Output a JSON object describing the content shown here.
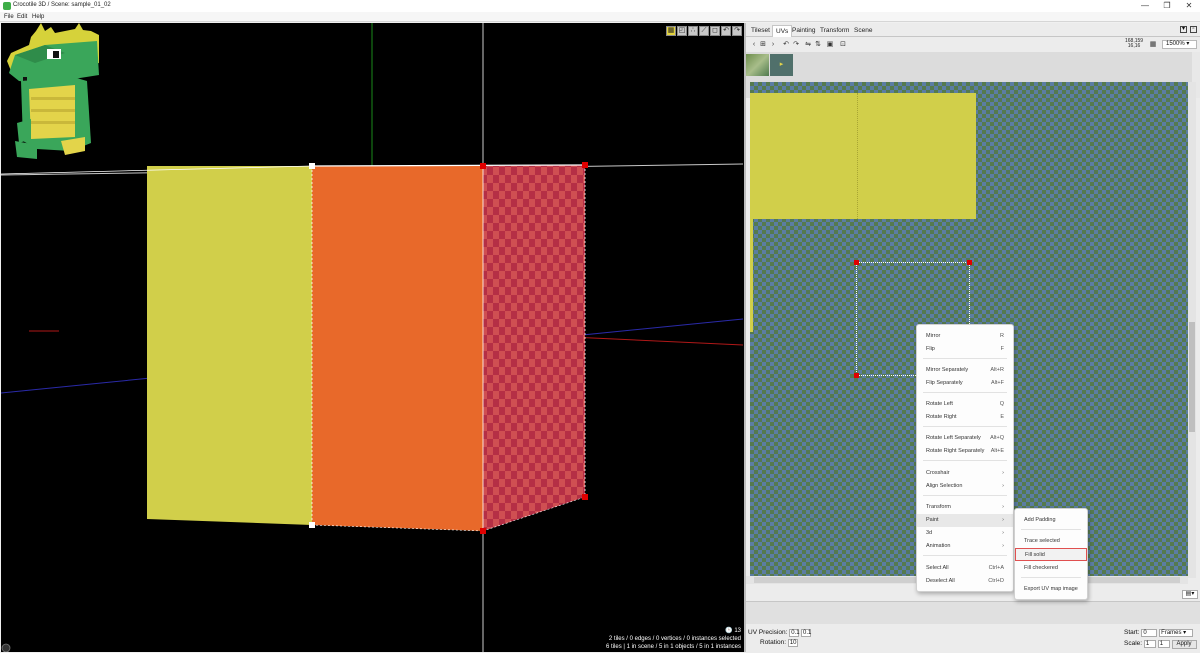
{
  "window": {
    "title": "Crocotile 3D / Scene: sample_01_02",
    "minimize": "—",
    "restore": "❐",
    "close": "✕"
  },
  "menubar": {
    "items": [
      "File",
      "Edit",
      "Help"
    ]
  },
  "viewport": {
    "toolbar_icons": [
      "select-tiles-icon",
      "select-faces-icon",
      "vertex-icon",
      "edge-icon",
      "object-icon",
      "undo-icon",
      "redo-icon"
    ],
    "stats_count": "13",
    "stats_line1": "2 tiles / 0 edges / 0 vertices / 0 instances selected",
    "stats_line2": "6 tiles | 1 in scene / 5 in 1 objects / 5 in 1 instances",
    "colors": {
      "yellow_face": "#d1cf4a",
      "orange_face": "#e8692a",
      "checker_a": "#b52f45",
      "checker_b": "#cf4f52"
    }
  },
  "right_panel": {
    "tabs": [
      "Tileset",
      "UVs",
      "Painting",
      "Transform",
      "Scene"
    ],
    "active_tab": "UVs",
    "coords_line1": "168,159",
    "coords_line2": "16,16",
    "zoom": "1500%",
    "uv_precision_label": "UV Precision:",
    "uv_precision_x": "0.1",
    "uv_precision_y": "0.1",
    "rotation_label": "Rotation:",
    "rotation_value": "10",
    "start_label": "Start:",
    "start_value": "0",
    "frames_select": "Frames",
    "scale_label": "Scale:",
    "scale_x": "1",
    "scale_y": "1",
    "apply_label": "Apply"
  },
  "context_menu": {
    "items": [
      {
        "label": "Mirror",
        "shortcut": "R"
      },
      {
        "label": "Flip",
        "shortcut": "F"
      },
      {
        "label": "Mirror Separately",
        "shortcut": "Alt+R"
      },
      {
        "label": "Flip Separately",
        "shortcut": "Alt+F"
      },
      {
        "label": "Rotate Left",
        "shortcut": "Q"
      },
      {
        "label": "Rotate Right",
        "shortcut": "E"
      },
      {
        "label": "Rotate Left Separately",
        "shortcut": "Alt+Q"
      },
      {
        "label": "Rotate Right Separately",
        "shortcut": "Alt+E"
      },
      {
        "label": "Crosshair",
        "shortcut": "›"
      },
      {
        "label": "Align Selection",
        "shortcut": "›"
      },
      {
        "label": "Transform",
        "shortcut": "›"
      },
      {
        "label": "Paint",
        "shortcut": "›"
      },
      {
        "label": "3d",
        "shortcut": "›"
      },
      {
        "label": "Animation",
        "shortcut": "›"
      },
      {
        "label": "Select All",
        "shortcut": "Ctrl+A"
      },
      {
        "label": "Deselect All",
        "shortcut": "Ctrl+D"
      }
    ]
  },
  "submenu": {
    "items": [
      "Add Padding",
      "Trace selected",
      "Fill solid",
      "Fill checkered",
      "Export UV map image"
    ]
  }
}
